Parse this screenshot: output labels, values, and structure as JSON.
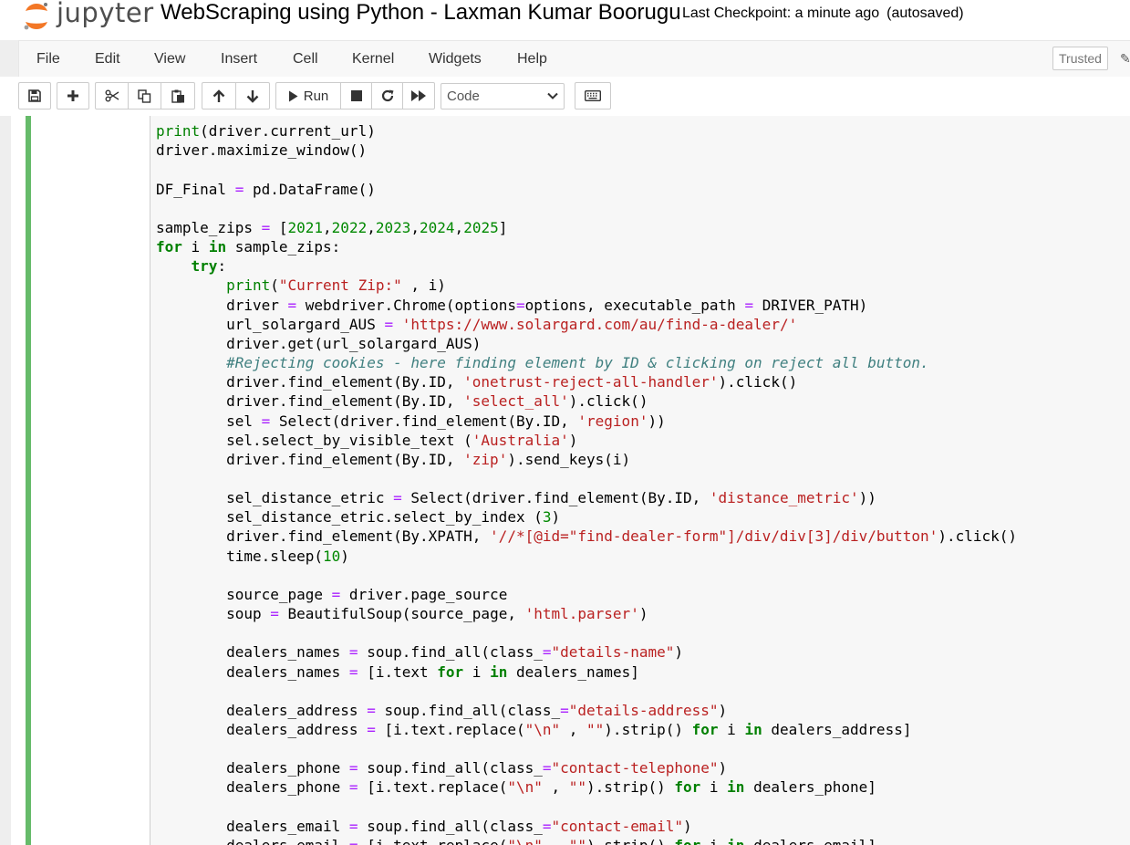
{
  "header": {
    "logo_text": "jupyter",
    "notebook_title": "WebScraping using Python - Laxman Kumar Boorugu",
    "checkpoint": "Last Checkpoint: a minute ago",
    "autosave": "(autosaved)"
  },
  "menu": {
    "items": [
      "File",
      "Edit",
      "View",
      "Insert",
      "Cell",
      "Kernel",
      "Widgets",
      "Help"
    ],
    "trusted": "Trusted"
  },
  "toolbar": {
    "run_label": "Run",
    "cell_type": "Code",
    "cell_type_options": [
      "Code"
    ]
  },
  "cell": {
    "lines": [
      "print(driver.current_url)",
      "driver.maximize_window()",
      "",
      "DF_Final = pd.DataFrame()",
      "",
      "sample_zips = [2021,2022,2023,2024,2025]",
      "for i in sample_zips:",
      "    try:",
      "        print(\"Current Zip:\" , i)",
      "        driver = webdriver.Chrome(options=options, executable_path = DRIVER_PATH)",
      "        url_solargard_AUS = 'https://www.solargard.com/au/find-a-dealer/'",
      "        driver.get(url_solargard_AUS)",
      "        #Rejecting cookies - here finding element by ID & clicking on reject all button.",
      "        driver.find_element(By.ID, 'onetrust-reject-all-handler').click()",
      "        driver.find_element(By.ID, 'select_all').click()",
      "        sel = Select(driver.find_element(By.ID, 'region'))",
      "        sel.select_by_visible_text ('Australia')",
      "        driver.find_element(By.ID, 'zip').send_keys(i)",
      "",
      "        sel_distance_etric = Select(driver.find_element(By.ID, 'distance_metric'))",
      "        sel_distance_etric.select_by_index (3)",
      "        driver.find_element(By.XPATH, '//*[@id=\"find-dealer-form\"]/div/div[3]/div/button').click()",
      "        time.sleep(10)",
      "",
      "        source_page = driver.page_source",
      "        soup = BeautifulSoup(source_page, 'html.parser')",
      "",
      "        dealers_names = soup.find_all(class_=\"details-name\")",
      "        dealers_names = [i.text for i in dealers_names]",
      "",
      "        dealers_address = soup.find_all(class_=\"details-address\")",
      "        dealers_address = [i.text.replace(\"\\n\" , \"\").strip() for i in dealers_address]",
      "",
      "        dealers_phone = soup.find_all(class_=\"contact-telephone\")",
      "        dealers_phone = [i.text.replace(\"\\n\" , \"\").strip() for i in dealers_phone]",
      "",
      "        dealers_email = soup.find_all(class_=\"contact-email\")",
      "        dealers_email = [i.text.replace(\"\\n\" , \"\").strip() for i in dealers_email]"
    ]
  },
  "colors": {
    "cell_bar": "#66bb6a",
    "keyword": "#008000",
    "string": "#ba2121",
    "operator": "#aa22ff",
    "comment": "#408080"
  }
}
